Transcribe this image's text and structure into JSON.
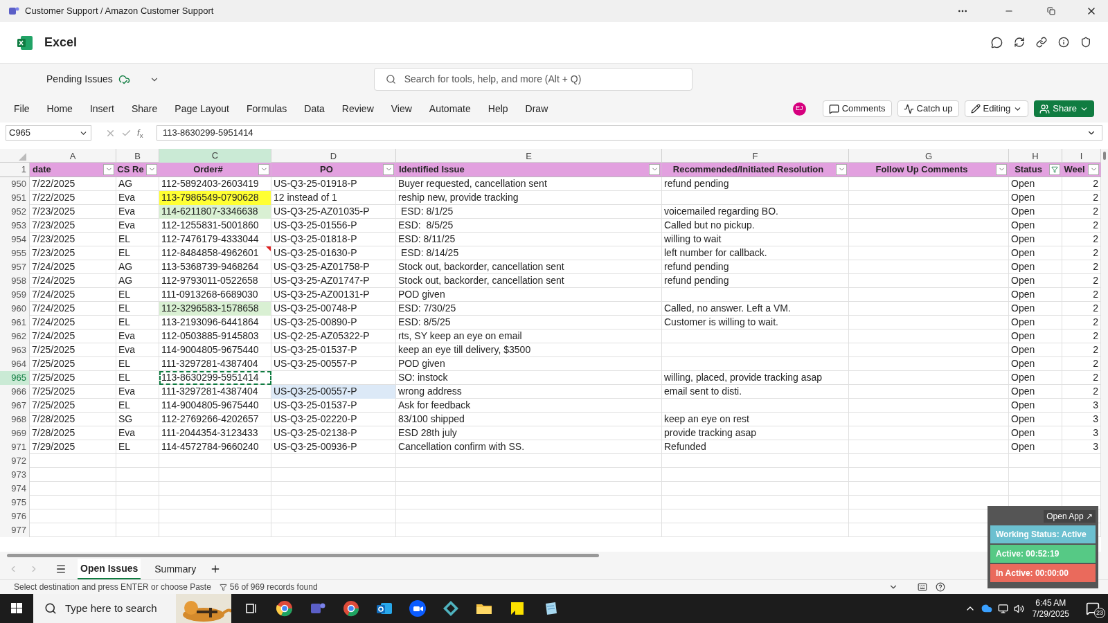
{
  "title_bar": {
    "title": "Customer Support / Amazon Customer Support"
  },
  "app": {
    "name": "Excel"
  },
  "file": {
    "name": "Pending Issues"
  },
  "search": {
    "placeholder": "Search for tools, help, and more (Alt + Q)"
  },
  "menu": [
    "File",
    "Home",
    "Insert",
    "Share",
    "Page Layout",
    "Formulas",
    "Data",
    "Review",
    "View",
    "Automate",
    "Help",
    "Draw"
  ],
  "user": {
    "initials": "EJ"
  },
  "actions": [
    {
      "kind": "comments",
      "label": "Comments"
    },
    {
      "kind": "catchup",
      "label": "Catch up"
    },
    {
      "kind": "editing",
      "label": "Editing"
    },
    {
      "kind": "share",
      "label": "Share"
    }
  ],
  "formula_bar": {
    "name_box": "C965",
    "function_label": "*f*$_{x}$",
    "value": "113-8630299-5951414"
  },
  "column_letters": [
    {
      "label": "A",
      "selected": false
    },
    {
      "label": "B",
      "selected": false
    },
    {
      "label": "C",
      "selected": true
    },
    {
      "label": "D",
      "selected": false
    },
    {
      "label": "E",
      "selected": false
    },
    {
      "label": "F",
      "selected": false
    },
    {
      "label": "G",
      "selected": false
    },
    {
      "label": "H",
      "selected": false
    },
    {
      "label": "I",
      "selected": false
    }
  ],
  "header_row": {
    "number": "1",
    "columns": [
      {
        "label": "date",
        "filtered": false
      },
      {
        "label": "CS Re",
        "filtered": false
      },
      {
        "label": "Order#",
        "filtered": false
      },
      {
        "label": "PO",
        "filtered": false
      },
      {
        "label": "Identified Issue",
        "filtered": false
      },
      {
        "label": "Recommended/Initiated Resolution",
        "filtered": false
      },
      {
        "label": "Follow Up Comments",
        "filtered": false
      },
      {
        "label": "Status",
        "filtered": true
      },
      {
        "label": "Weel",
        "filtered": false
      }
    ]
  },
  "rows": [
    {
      "number": "950",
      "selected": false,
      "comment": false,
      "date": "7/22/2025",
      "rep": "AG",
      "order": "112-5892403-2603419",
      "po": "US-Q3-25-01918-P",
      "issue": "Buyer requested, cancellation sent",
      "resolution": "refund pending",
      "status": "Open",
      "week": "2"
    },
    {
      "number": "951",
      "selected": false,
      "comment": false,
      "order_highlight": {
        "color": "#ffff33"
      },
      "date": "7/22/2025",
      "rep": "Eva",
      "order": "113-7986549-0790628",
      "po": "12 instead of 1",
      "issue": "reship new, provide tracking",
      "status": "Open",
      "week": "2"
    },
    {
      "number": "952",
      "selected": false,
      "comment": false,
      "order_highlight": {
        "color": "#d9f0d3"
      },
      "date": "7/23/2025",
      "rep": "Eva",
      "order": "114-6211807-3346638",
      "po": "US-Q3-25-AZ01035-P",
      "issue": " ESD: 8/1/25",
      "resolution": "voicemailed regarding BO.",
      "status": "Open",
      "week": "2"
    },
    {
      "number": "953",
      "selected": false,
      "comment": false,
      "date": "7/23/2025",
      "rep": "Eva",
      "order": "112-1255831-5001860",
      "po": "US-Q3-25-01556-P",
      "issue": "ESD:  8/5/25",
      "resolution": "Called but no pickup.",
      "status": "Open",
      "week": "2"
    },
    {
      "number": "954",
      "selected": false,
      "comment": false,
      "date": "7/23/2025",
      "rep": "EL",
      "order": "112-7476179-4333044",
      "po": "US-Q3-25-01818-P",
      "issue": "ESD: 8/11/25",
      "resolution": "willing to wait",
      "status": "Open",
      "week": "2"
    },
    {
      "number": "955",
      "selected": false,
      "comment": true,
      "date": "7/23/2025",
      "rep": "EL",
      "order": "112-8484858-4962601",
      "po": "US-Q3-25-01630-P",
      "issue": " ESD: 8/14/25",
      "resolution": "left number for callback.",
      "status": "Open",
      "week": "2"
    },
    {
      "number": "957",
      "selected": false,
      "comment": false,
      "date": "7/24/2025",
      "rep": "AG",
      "order": "113-5368739-9468264",
      "po": "US-Q3-25-AZ01758-P",
      "issue": "Stock out, backorder, cancellation sent",
      "resolution": "refund pending",
      "status": "Open",
      "week": "2"
    },
    {
      "number": "958",
      "selected": false,
      "comment": false,
      "date": "7/24/2025",
      "rep": "AG",
      "order": "112-9793011-0522658",
      "po": "US-Q3-25-AZ01747-P",
      "issue": "Stock out, backorder, cancellation sent",
      "resolution": "refund pending",
      "status": "Open",
      "week": "2"
    },
    {
      "number": "959",
      "selected": false,
      "comment": false,
      "date": "7/24/2025",
      "rep": "EL",
      "order": "111-0913268-6689030",
      "po": "US-Q3-25-AZ00131-P",
      "issue": "POD given",
      "status": "Open",
      "week": "2"
    },
    {
      "number": "960",
      "selected": false,
      "comment": false,
      "order_highlight": {
        "color": "#d9f0d3"
      },
      "date": "7/24/2025",
      "rep": "EL",
      "order": "112-3296583-1578658",
      "po": "US-Q3-25-00748-P",
      "issue": "ESD: 7/30/25",
      "resolution": "Called, no answer. Left a VM.",
      "status": "Open",
      "week": "2"
    },
    {
      "number": "961",
      "selected": false,
      "comment": false,
      "date": "7/24/2025",
      "rep": "EL",
      "order": "113-2193096-6441864",
      "po": "US-Q3-25-00890-P",
      "issue": "ESD: 8/5/25",
      "resolution": "Customer is willing to wait.",
      "status": "Open",
      "week": "2"
    },
    {
      "number": "962",
      "selected": false,
      "comment": false,
      "date": "7/24/2025",
      "rep": "Eva",
      "order": "112-0503885-9145803",
      "po": "US-Q2-25-AZ05322-P",
      "issue": "rts, SY keep an eye on email",
      "status": "Open",
      "week": "2"
    },
    {
      "number": "963",
      "selected": false,
      "comment": false,
      "date": "7/25/2025",
      "rep": "Eva",
      "order": "114-9004805-9675440",
      "po": "US-Q3-25-01537-P",
      "issue": "keep an eye till delivery, $3500",
      "status": "Open",
      "week": "2"
    },
    {
      "number": "964",
      "selected": false,
      "comment": false,
      "date": "7/25/2025",
      "rep": "EL",
      "order": "111-3297281-4387404",
      "po": "US-Q3-25-00557-P",
      "issue": "POD given",
      "status": "Open",
      "week": "2"
    },
    {
      "number": "965",
      "selected": true,
      "comment": false,
      "date": "7/25/2025",
      "rep": "EL",
      "order": "113-8630299-5951414",
      "issue": "SO: instock",
      "resolution": "willing, placed, provide tracking asap",
      "status": "Open",
      "week": "2"
    },
    {
      "number": "966",
      "selected": false,
      "comment": false,
      "po_highlight": {
        "color": "#dce9f7"
      },
      "date": "7/25/2025",
      "rep": "Eva",
      "order": "111-3297281-4387404",
      "po": "US-Q3-25-00557-P",
      "issue": "wrong address",
      "resolution": "email sent to disti.",
      "status": "Open",
      "week": "2"
    },
    {
      "number": "967",
      "selected": false,
      "comment": false,
      "date": "7/25/2025",
      "rep": "EL",
      "order": "114-9004805-9675440",
      "po": "US-Q3-25-01537-P",
      "issue": "Ask for feedback",
      "status": "Open",
      "week": "3"
    },
    {
      "number": "968",
      "selected": false,
      "comment": false,
      "date": "7/28/2025",
      "rep": "SG",
      "order": "112-2769266-4202657",
      "po": "US-Q3-25-02220-P",
      "issue": "83/100 shipped",
      "resolution": "keep an eye on rest",
      "status": "Open",
      "week": "3"
    },
    {
      "number": "969",
      "selected": false,
      "comment": false,
      "date": "7/28/2025",
      "rep": "Eva",
      "order": "111-2044354-3123433",
      "po": "US-Q3-25-02138-P",
      "issue": "ESD 28th july",
      "resolution": "provide tracking asap",
      "status": "Open",
      "week": "3"
    },
    {
      "number": "971",
      "selected": false,
      "comment": false,
      "date": "7/29/2025",
      "rep": "EL",
      "order": "114-4572784-9660240",
      "po": "US-Q3-25-00936-P",
      "issue": "Cancellation confirm with SS.",
      "resolution": "Refunded",
      "status": "Open",
      "week": "3"
    }
  ],
  "empty_rows": [
    "972",
    "973",
    "974",
    "975",
    "976",
    "977"
  ],
  "sheets": [
    {
      "label": "Open Issues",
      "selected": true
    },
    {
      "label": "Summary",
      "selected": false
    }
  ],
  "status_bar": {
    "message": "Select destination and press ENTER or choose Paste",
    "records": "56 of 969 records found"
  },
  "tracker": {
    "open_app": "Open App ↗",
    "status": "Working Status: Active",
    "active": "Active: 00:52:19",
    "inactive": "In Active: 00:00:00"
  },
  "taskbar": {
    "search_placeholder": "Type here to search",
    "time": "6:45 AM",
    "date": "7/29/2025",
    "notifications": "23"
  }
}
